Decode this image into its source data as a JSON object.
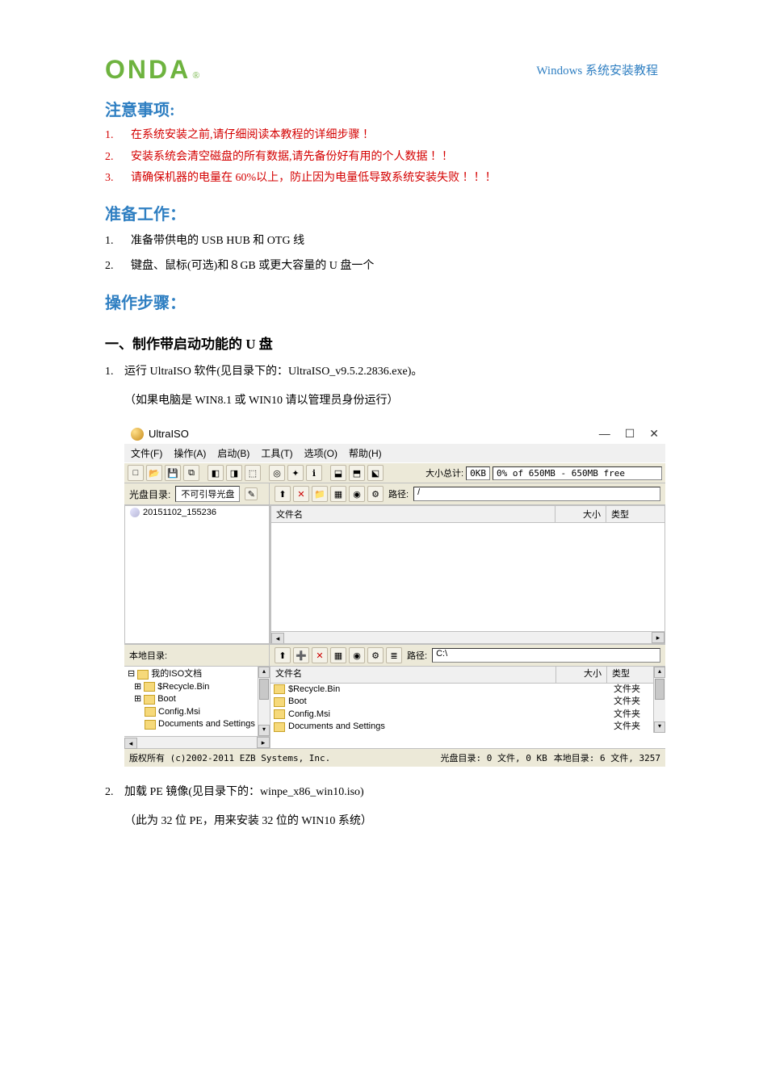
{
  "header": {
    "logo_text": "ONDA",
    "logo_reg": "®",
    "doc_title": "Windows 系统安装教程"
  },
  "sections": {
    "warn_title": "注意事项:",
    "warnings": [
      "在系统安装之前,请仔细阅读本教程的详细步骤  ！",
      "安装系统会清空磁盘的所有数据,请先备份好有用的个人数据  ！！",
      "请确保机器的电量在 60%以上，防止因为电量低导致系统安装失败  ！！！"
    ],
    "prep_title": "准备工作：",
    "preps": [
      "准备带供电的 USB HUB 和 OTG 线",
      "键盘、鼠标(可选)和８GB 或更大容量的 U 盘一个"
    ],
    "steps_title": "操作步骤：",
    "step1_h": "一、制作带启动功能的 U 盘",
    "step1_1": "运行 UltraISO 软件(见目录下的：UltraISO_v9.5.2.2836.exe)。",
    "step1_1_sub": "（如果电脑是 WIN8.1 或 WIN10 请以管理员身份运行）",
    "step1_2": "加载 PE 镜像(见目录下的：winpe_x86_win10.iso)",
    "step1_2_sub": "（此为 32 位 PE，用来安装 32 位的 WIN10 系统）"
  },
  "app": {
    "title": "UltraISO",
    "menus": [
      "文件(F)",
      "操作(A)",
      "启动(B)",
      "工具(T)",
      "选项(O)",
      "帮助(H)"
    ],
    "size_label": "大小总计:",
    "size_kb": "0KB",
    "size_free": "0% of 650MB - 650MB free",
    "disc_label_caption": "光盘目录:",
    "disc_label_value": "不可引导光盘",
    "path_label": "路径:",
    "path_top": "/",
    "tree_top_item": "20151102_155236",
    "cols": {
      "name": "文件名",
      "size": "大小",
      "type": "类型"
    },
    "local_label": "本地目录:",
    "path_bottom": "C:\\",
    "tree_bottom_root": "我的ISO文档",
    "tree_bottom_items": [
      "$Recycle.Bin",
      "Boot",
      "Config.Msi",
      "Documents and Settings"
    ],
    "file_list": [
      {
        "name": "$Recycle.Bin",
        "type": "文件夹"
      },
      {
        "name": "Boot",
        "type": "文件夹"
      },
      {
        "name": "Config.Msi",
        "type": "文件夹"
      },
      {
        "name": "Documents and Settings",
        "type": "文件夹"
      }
    ],
    "status_copyright": "版权所有 (c)2002-2011 EZB Systems, Inc.",
    "status_disc": "光盘目录: 0 文件, 0 KB",
    "status_local": "本地目录: 6 文件, 3257"
  }
}
